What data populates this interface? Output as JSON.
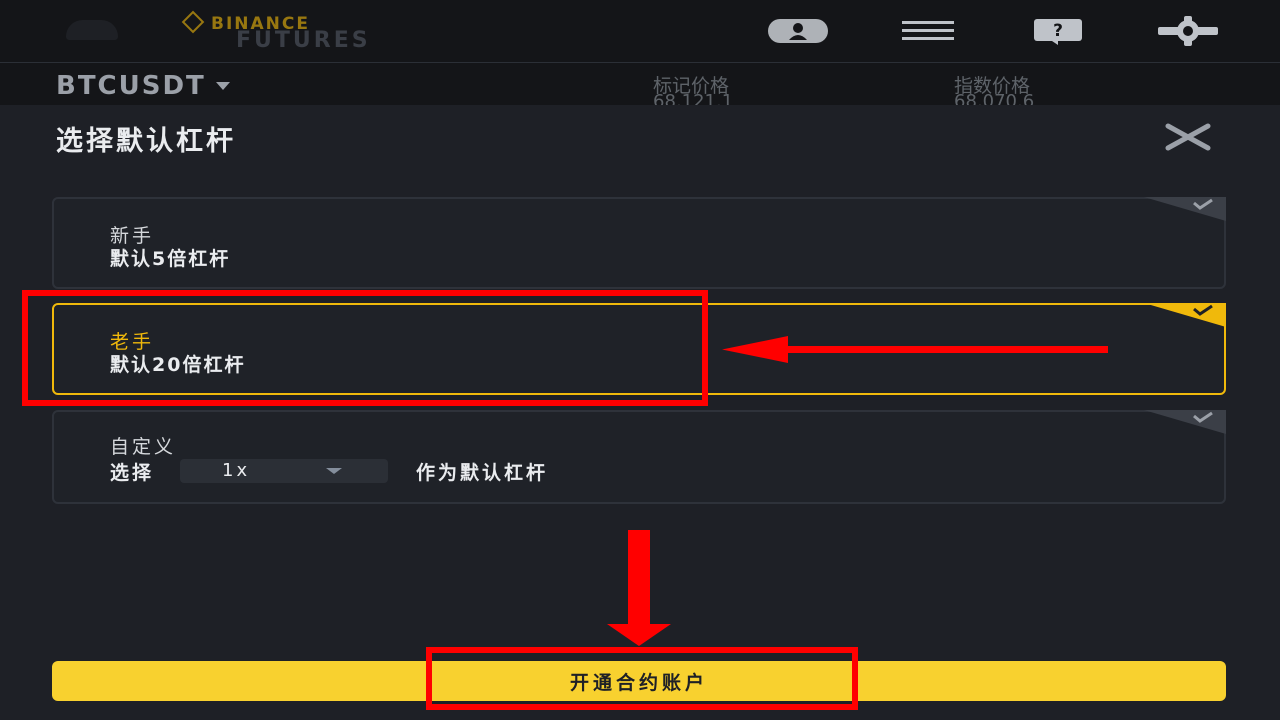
{
  "topbar": {
    "brand_name": "BINANCE",
    "brand_sub": "FUTURES",
    "icons": [
      "user-icon",
      "menu-icon",
      "help-icon",
      "gear-icon"
    ]
  },
  "ticker": {
    "symbol": "BTCUSDT",
    "mark_price_label": "标记价格",
    "mark_price_value": "68,121.1",
    "index_price_label": "指数价格",
    "index_price_value": "68,070.6"
  },
  "sheet": {
    "title": "选择默认杠杆",
    "options": [
      {
        "title": "新手",
        "desc": "默认5倍杠杆",
        "selected": false
      },
      {
        "title": "老手",
        "desc": "默认20倍杠杆",
        "selected": true
      },
      {
        "title": "自定义",
        "prefix": "选择",
        "select_value": "1x",
        "suffix": "作为默认杠杆",
        "selected": false
      }
    ],
    "open_button": "开通合约账户"
  },
  "colors": {
    "accent": "#f0b90b",
    "button": "#f8d12f",
    "annotation": "#ff0000",
    "background": "#1e2026"
  }
}
